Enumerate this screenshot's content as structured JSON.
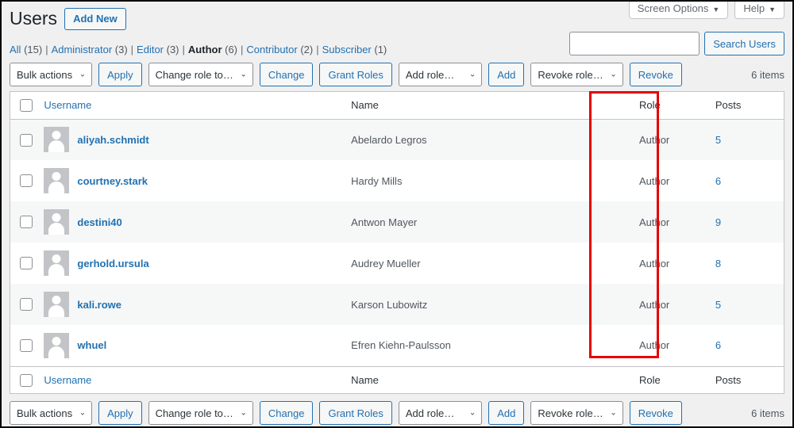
{
  "meta_tabs": [
    {
      "label": "Screen Options",
      "caret": "▼"
    },
    {
      "label": "Help",
      "caret": "▼"
    }
  ],
  "header": {
    "title": "Users",
    "add_new_label": "Add New"
  },
  "search": {
    "value": "",
    "placeholder": "",
    "button_label": "Search Users"
  },
  "filters": [
    {
      "label": "All",
      "count": "(15)",
      "current": false
    },
    {
      "label": "Administrator",
      "count": "(3)",
      "current": false
    },
    {
      "label": "Editor",
      "count": "(3)",
      "current": false
    },
    {
      "label": "Author",
      "count": "(6)",
      "current": true
    },
    {
      "label": "Contributor",
      "count": "(2)",
      "current": false
    },
    {
      "label": "Subscriber",
      "count": "(1)",
      "current": false
    }
  ],
  "toolbar": {
    "bulk_actions_label": "Bulk actions",
    "apply_label": "Apply",
    "change_role_label": "Change role to…",
    "change_label": "Change",
    "grant_roles_label": "Grant Roles",
    "add_role_label": "Add role…",
    "add_label": "Add",
    "revoke_role_label": "Revoke role…",
    "revoke_label": "Revoke",
    "items_count": "6 items",
    "chevron": "⌄"
  },
  "table": {
    "columns": {
      "username": "Username",
      "name": "Name",
      "role": "Role",
      "posts": "Posts"
    },
    "rows": [
      {
        "username": "aliyah.schmidt",
        "name": "Abelardo Legros",
        "role": "Author",
        "posts": "5"
      },
      {
        "username": "courtney.stark",
        "name": "Hardy Mills",
        "role": "Author",
        "posts": "6"
      },
      {
        "username": "destini40",
        "name": "Antwon Mayer",
        "role": "Author",
        "posts": "9"
      },
      {
        "username": "gerhold.ursula",
        "name": "Audrey Mueller",
        "role": "Author",
        "posts": "8"
      },
      {
        "username": "kali.rowe",
        "name": "Karson Lubowitz",
        "role": "Author",
        "posts": "5"
      },
      {
        "username": "whuel",
        "name": "Efren Kiehn-Paulsson",
        "role": "Author",
        "posts": "6"
      }
    ]
  },
  "annotation": {
    "color": "#e60000",
    "target_column": "Role"
  }
}
